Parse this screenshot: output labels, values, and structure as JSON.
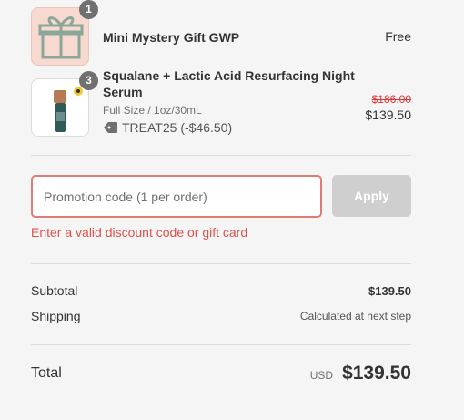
{
  "items": [
    {
      "name": "Mini Mystery Gift GWP",
      "quantity": "1",
      "price": "Free",
      "thumbnail_icon": "gift-icon"
    },
    {
      "name_line1": "Squalane + Lactic Acid Resurfacing Night",
      "name_line2": "Serum",
      "variant": "Full Size / 1oz/30mL",
      "quantity": "3",
      "discount_code": "TREAT25 (-$46.50)",
      "original_price": "$186.00",
      "price": "$139.50",
      "thumbnail_icon": "serum-bottle-icon"
    }
  ],
  "promo": {
    "placeholder": "Promotion code (1 per order)",
    "value": "",
    "apply_label": "Apply",
    "error": "Enter a valid discount code or gift card"
  },
  "summary": {
    "subtotal_label": "Subtotal",
    "subtotal_value": "$139.50",
    "shipping_label": "Shipping",
    "shipping_value": "Calculated at next step",
    "total_label": "Total",
    "currency": "USD",
    "total_value": "$139.50"
  },
  "colors": {
    "error": "#e0514b",
    "input_border": "#e07b78",
    "strike_price": "#d33333",
    "button_disabled": "#cfcfcf"
  }
}
